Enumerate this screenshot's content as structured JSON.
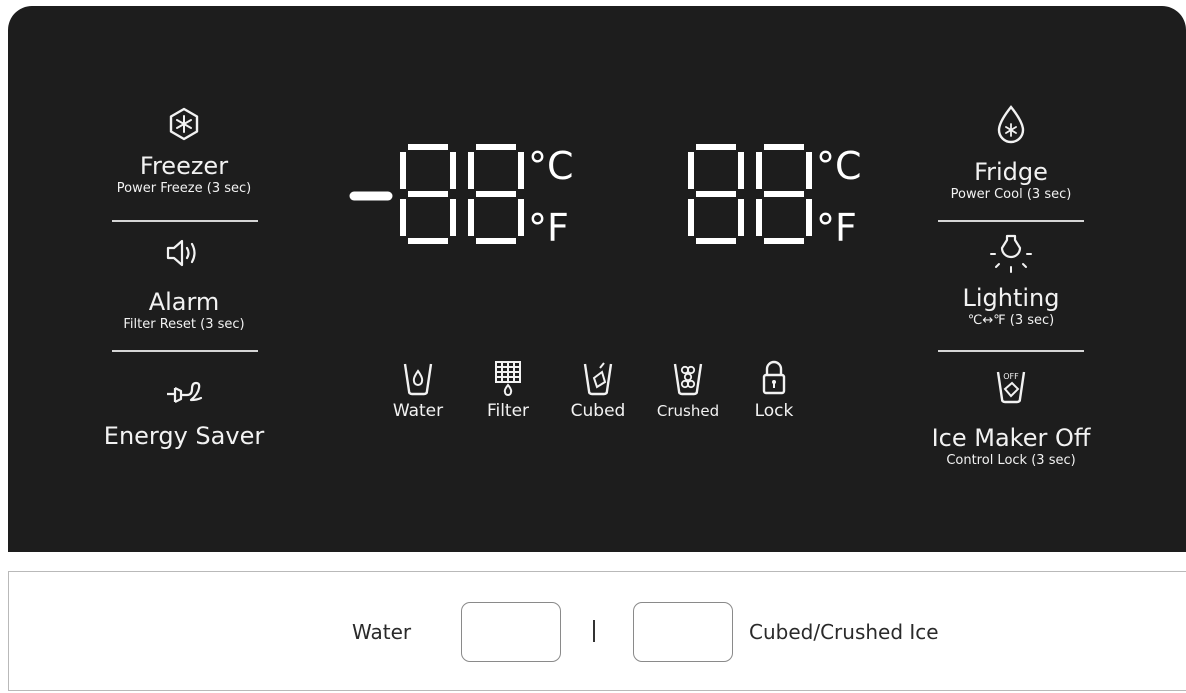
{
  "left_controls": {
    "freezer": {
      "label": "Freezer",
      "sub": "Power Freeze (3 sec)"
    },
    "alarm": {
      "label": "Alarm",
      "sub": "Filter Reset (3 sec)"
    },
    "energy_saver": {
      "label": "Energy Saver"
    }
  },
  "right_controls": {
    "fridge": {
      "label": "Fridge",
      "sub": "Power Cool (3 sec)"
    },
    "lighting": {
      "label": "Lighting",
      "sub": "℃↔℉ (3 sec)"
    },
    "ice_maker": {
      "label": "Ice Maker Off",
      "sub": "Control Lock (3 sec)"
    }
  },
  "display": {
    "freezer_temp": "-88",
    "fridge_temp": "88",
    "unit_c": "°C",
    "unit_f": "°F"
  },
  "status": [
    {
      "label": "Water",
      "icon": "water-icon"
    },
    {
      "label": "Filter",
      "icon": "filter-icon"
    },
    {
      "label": "Cubed",
      "icon": "cubed-ice-icon"
    },
    {
      "label": "Crushed",
      "icon": "crushed-ice-icon"
    },
    {
      "label": "Lock",
      "icon": "lock-icon"
    }
  ],
  "dispenser": {
    "water_label": "Water",
    "separator": "|",
    "ice_label": "Cubed/Crushed Ice"
  },
  "colors": {
    "panel": "#1d1d1d",
    "lit": "#ffffff",
    "text": "#f2f2f2"
  }
}
